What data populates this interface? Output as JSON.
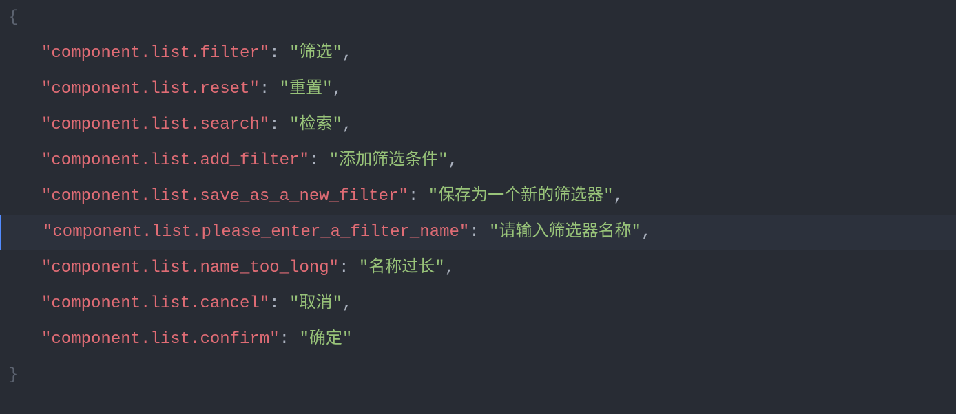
{
  "code": {
    "open_brace": "{",
    "close_brace": "}",
    "entries": [
      {
        "key": "\"component.list.filter\"",
        "value": "\"筛选\"",
        "trailing": ","
      },
      {
        "key": "\"component.list.reset\"",
        "value": "\"重置\"",
        "trailing": ","
      },
      {
        "key": "\"component.list.search\"",
        "value": "\"检索\"",
        "trailing": ","
      },
      {
        "key": "\"component.list.add_filter\"",
        "value": "\"添加筛选条件\"",
        "trailing": ","
      },
      {
        "key": "\"component.list.save_as_a_new_filter\"",
        "value": "\"保存为一个新的筛选器\"",
        "trailing": ","
      },
      {
        "key": "\"component.list.please_enter_a_filter_name\"",
        "value": "\"请输入筛选器名称\"",
        "trailing": ","
      },
      {
        "key": "\"component.list.name_too_long\"",
        "value": "\"名称过长\"",
        "trailing": ","
      },
      {
        "key": "\"component.list.cancel\"",
        "value": "\"取消\"",
        "trailing": ","
      },
      {
        "key": "\"component.list.confirm\"",
        "value": "\"确定\"",
        "trailing": ""
      }
    ],
    "highlighted_index": 5
  }
}
